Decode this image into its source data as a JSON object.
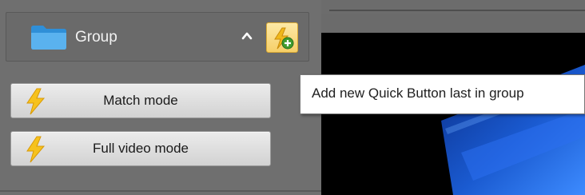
{
  "group": {
    "label": "Group",
    "folder_icon": "folder-icon",
    "collapse_icon": "chevron-up-icon",
    "add_button_icon": "add-quick-button-icon",
    "accent_color": "#f6cf68"
  },
  "quick_buttons": [
    {
      "label": "Match mode",
      "icon": "lightning-icon"
    },
    {
      "label": "Full video mode",
      "icon": "lightning-icon"
    }
  ],
  "tooltip": {
    "text": "Add new Quick Button last in group"
  },
  "video": {
    "background_color": "#000000",
    "accent_color": "#1a5ad0"
  }
}
